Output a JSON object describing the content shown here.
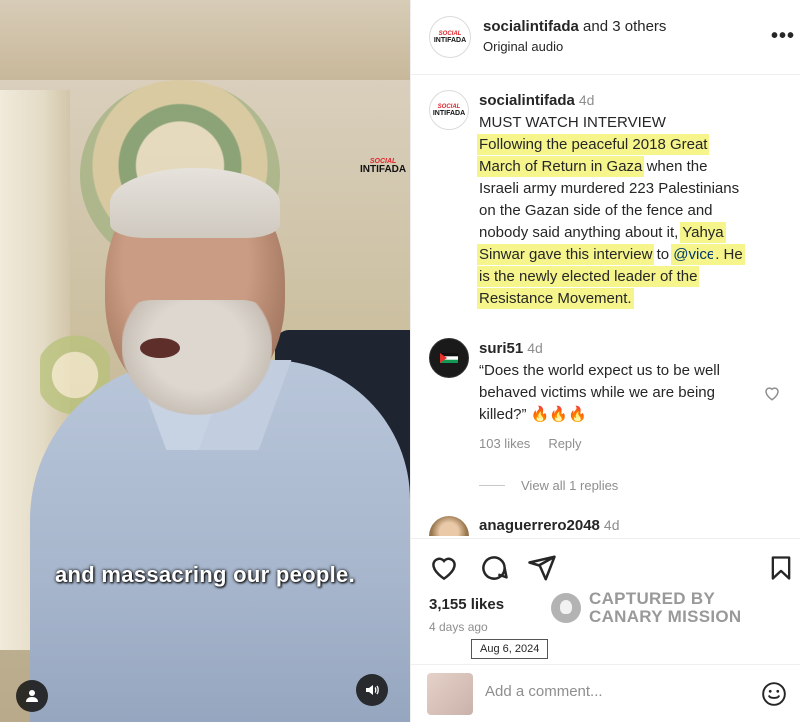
{
  "video": {
    "caption": "and massacring our people.",
    "brand_line1": "SOCIAL",
    "brand_line2": "INTIFADA"
  },
  "header": {
    "username": "socialintifada",
    "others": " and 3 others",
    "audio": "Original audio",
    "more": "•••",
    "avatar_line1": "SOCIAL",
    "avatar_line2": "INTIFADA"
  },
  "caption_comment": {
    "username": "socialintifada",
    "time": "4d",
    "lines": {
      "l1": "MUST WATCH INTERVIEW",
      "l2": "Following the peaceful 2018 Great",
      "l3": "March of Return in Gaza",
      "l3b": " when the",
      "l4": "Israeli army murdered 223 Palestinians",
      "l5": "on the Gazan side of the fence and",
      "l6": "nobody said anything about it, ",
      "l6b": "Yahya",
      "l7": "Sinwar gave this interview",
      "l7b": " to ",
      "l7c": "@vice",
      "l7d": ". He",
      "l8": "is the newly elected leader of the",
      "l9": "Resistance Movement. "
    }
  },
  "comment1": {
    "username": "suri51",
    "time": "4d",
    "text": "“Does the world expect us to be well behaved victims while we are being killed?” 🔥🔥🔥",
    "likes": "103 likes",
    "reply": "Reply",
    "view_replies": "View all 1 replies"
  },
  "comment2": {
    "username": "anaguerrero2048",
    "time": "4d"
  },
  "post": {
    "likes": "3,155 likes",
    "ago": "4 days ago",
    "date_tooltip": "Aug 6, 2024"
  },
  "watermark": {
    "line1": "CAPTURED BY",
    "line2": "CANARY MISSION"
  },
  "add_comment": {
    "placeholder": "Add a comment..."
  }
}
